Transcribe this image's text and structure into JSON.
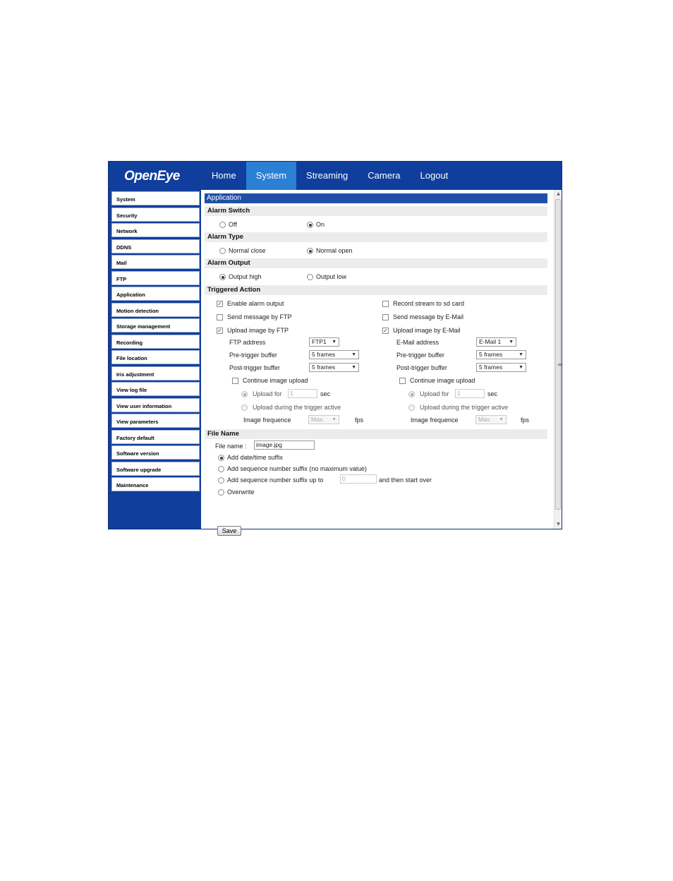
{
  "brand": {
    "logo": "OpenEye"
  },
  "nav": {
    "tabs": [
      "Home",
      "System",
      "Streaming",
      "Camera",
      "Logout"
    ],
    "active": "System"
  },
  "sidebar": {
    "items": [
      "System",
      "Security",
      "Network",
      "DDNS",
      "Mail",
      "FTP",
      "Application",
      "Motion detection",
      "Storage management",
      "Recording",
      "File location",
      "Iris adjustment",
      "View log file",
      "View user information",
      "View parameters",
      "Factory default",
      "Software version",
      "Software upgrade",
      "Maintenance"
    ]
  },
  "content": {
    "title": "Application",
    "alarm_switch": {
      "label": "Alarm Switch",
      "off": "Off",
      "on": "On"
    },
    "alarm_type": {
      "label": "Alarm Type",
      "normal_close": "Normal close",
      "normal_open": "Normal open"
    },
    "alarm_output": {
      "label": "Alarm Output",
      "high": "Output high",
      "low": "Output low"
    },
    "triggered": {
      "label": "Triggered Action",
      "enable_alarm_output": "Enable alarm output",
      "record_stream": "Record stream to sd card",
      "send_ftp": "Send message by FTP",
      "send_email": "Send message by E-Mail",
      "upload_ftp": "Upload image by FTP",
      "upload_email": "Upload image by E-Mail",
      "ftp_address_label": "FTP address",
      "ftp_address_value": "FTP1",
      "email_address_label": "E-Mail address",
      "email_address_value": "E-Mail 1",
      "pre_trigger_label": "Pre-trigger buffer",
      "post_trigger_label": "Post-trigger buffer",
      "frames_value": "5  frames",
      "continue_upload": "Continue image upload",
      "upload_for": "Upload for",
      "upload_for_value": "1",
      "sec": "sec",
      "upload_during": "Upload during the trigger active",
      "image_frequence": "Image frequence",
      "freq_value": "Max.",
      "fps": "fps"
    },
    "file_name": {
      "label": "File Name",
      "field_label": "File name :",
      "value": "image.jpg",
      "add_datetime": "Add date/time suffix",
      "add_seq_nomax": "Add sequence number suffix (no maximum value)",
      "add_seq_upto": "Add sequence number suffix up to",
      "upto_value": "0",
      "then_start_over": "and then start over",
      "overwrite": "Overwrite"
    },
    "save": "Save"
  }
}
